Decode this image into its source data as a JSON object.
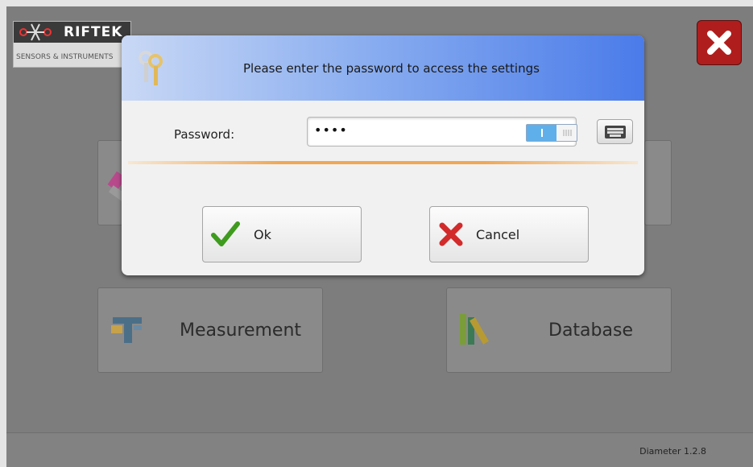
{
  "logo": {
    "brand": "RIFTEK",
    "tagline": "SENSORS & INSTRUMENTS"
  },
  "tiles": {
    "measurement": {
      "label": "Measurement",
      "icon": "caliper-icon"
    },
    "database": {
      "label": "Database",
      "icon": "books-icon"
    }
  },
  "dialog": {
    "title": "Please enter the password to access the settings",
    "password_label": "Password:",
    "password_value": "••••",
    "ok_label": "Ok",
    "cancel_label": "Cancel"
  },
  "footer": {
    "version": "Diameter 1.2.8"
  },
  "colors": {
    "header_gradient_start": "#c9d8f5",
    "header_gradient_end": "#4a7be9",
    "close": "#b01d1d",
    "divider": "#f0a756"
  }
}
